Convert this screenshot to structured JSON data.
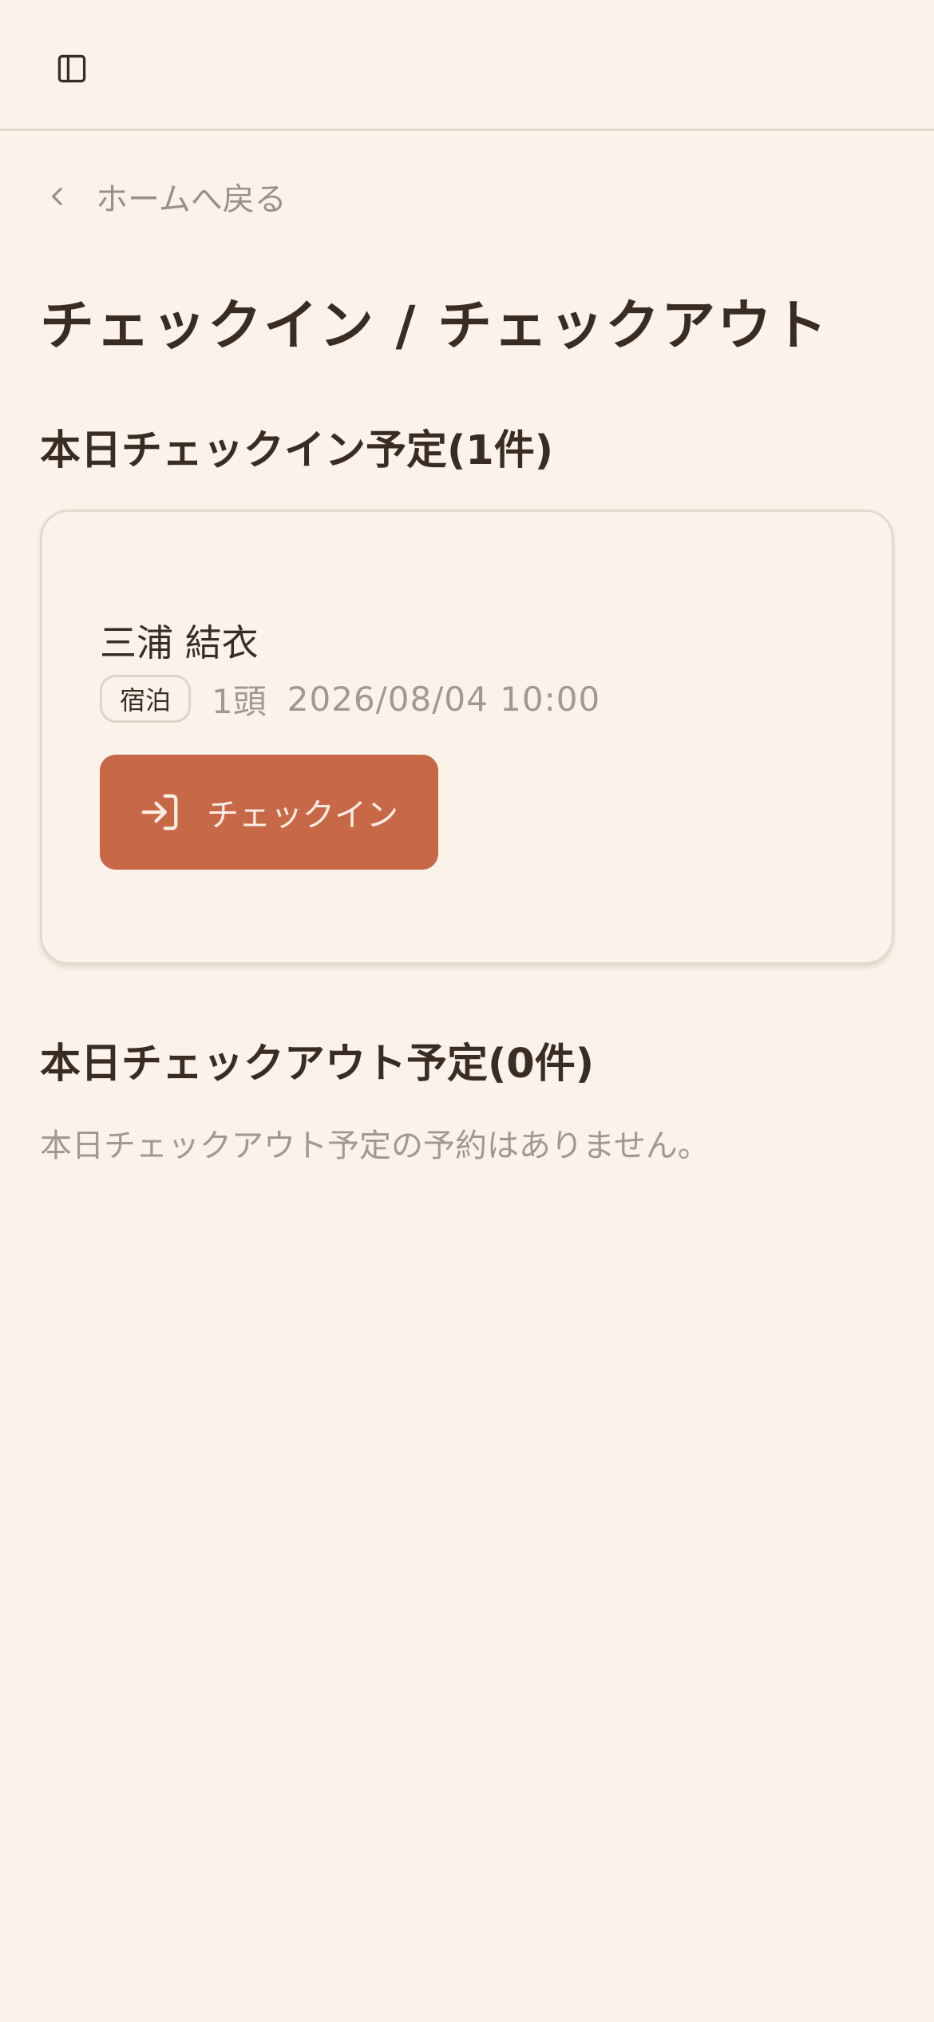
{
  "header": {
    "sidebar_icon": "sidebar-panel-icon"
  },
  "nav": {
    "back_label": "ホームへ戻る",
    "back_icon": "chevron-left-icon"
  },
  "page": {
    "title": "チェックイン / チェックアウト"
  },
  "checkin_section": {
    "title": "本日チェックイン予定(1件)",
    "reservations": [
      {
        "guest_name": "三浦 結衣",
        "stay_type": "宿泊",
        "pet_count": "1頭",
        "datetime": "2026/08/04 10:00",
        "action_label": "チェックイン",
        "action_icon": "log-in-icon"
      }
    ]
  },
  "checkout_section": {
    "title": "本日チェックアウト予定(0件)",
    "empty_message": "本日チェックアウト予定の予約はありません。"
  },
  "colors": {
    "background": "#fbf3ea",
    "text": "#3a2c22",
    "muted": "#a39890",
    "accent": "#c76846",
    "border": "#e3d9cd"
  }
}
